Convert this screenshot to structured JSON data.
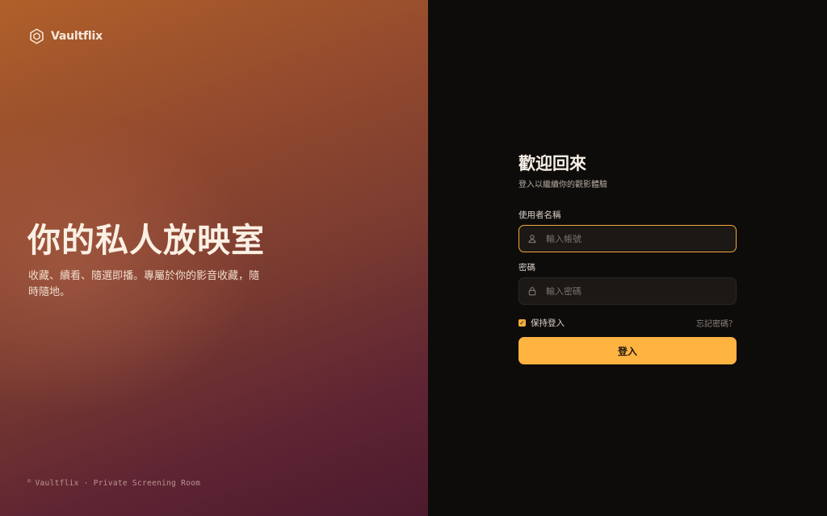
{
  "brand": {
    "name": "Vaultflix"
  },
  "hero": {
    "title": "你的私人放映室",
    "subtitle": "收藏、續看、隨選即播。專屬於你的影音收藏，隨時隨地。",
    "footer": "Vaultflix · Private Screening Room",
    "copyright_symbol": "©"
  },
  "login": {
    "title": "歡迎回來",
    "subtitle": "登入以繼續你的觀影體驗",
    "username": {
      "label": "使用者名稱",
      "value": "",
      "placeholder": "輸入帳號",
      "icon": "user-icon"
    },
    "password": {
      "label": "密碼",
      "value": "",
      "placeholder": "輸入密碼",
      "icon": "lock-icon"
    },
    "remember": {
      "label": "保持登入",
      "checked": true
    },
    "forgot_label": "忘記密碼？",
    "submit_label": "登入"
  },
  "colors": {
    "accent": "#ffb341",
    "focus_border": "#f2a93b",
    "panel_background": "#0e0c0b",
    "hero_gradient_start": "#b0602a",
    "hero_gradient_end": "#4c1a2e"
  }
}
